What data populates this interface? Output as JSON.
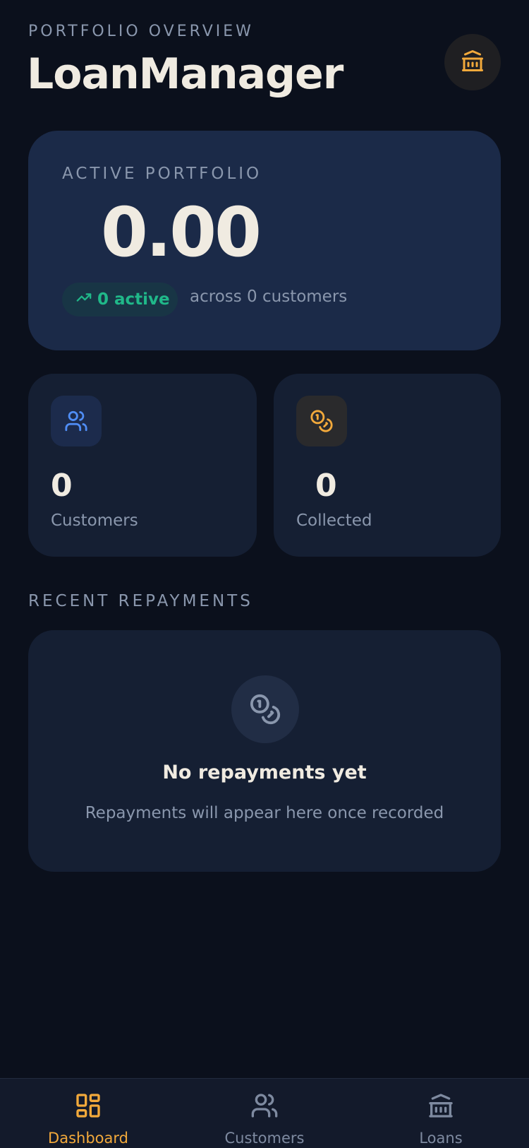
{
  "header": {
    "eyebrow": "PORTFOLIO OVERVIEW",
    "title": "LoanManager",
    "action_icon": "bank-icon"
  },
  "hero": {
    "label": "ACTIVE PORTFOLIO",
    "value": "0.00",
    "active_badge": "0 active",
    "subtext": "across 0 customers"
  },
  "stats": [
    {
      "icon": "users-icon",
      "value": "0",
      "label": "Customers",
      "accent": "#4f8df5"
    },
    {
      "icon": "coins-icon",
      "value": "0",
      "label": "Collected",
      "accent": "#f2a93b"
    }
  ],
  "recent": {
    "title": "RECENT REPAYMENTS",
    "empty_title": "No repayments yet",
    "empty_subtitle": "Repayments will appear here once recorded"
  },
  "nav": {
    "items": [
      {
        "label": "Dashboard",
        "icon": "dashboard-icon",
        "active": true
      },
      {
        "label": "Customers",
        "icon": "users-icon",
        "active": false
      },
      {
        "label": "Loans",
        "icon": "bank-icon",
        "active": false
      }
    ]
  },
  "colors": {
    "background": "#0b101c",
    "accent": "#f2a93b",
    "success": "#20b889",
    "muted": "#8a97ad"
  }
}
